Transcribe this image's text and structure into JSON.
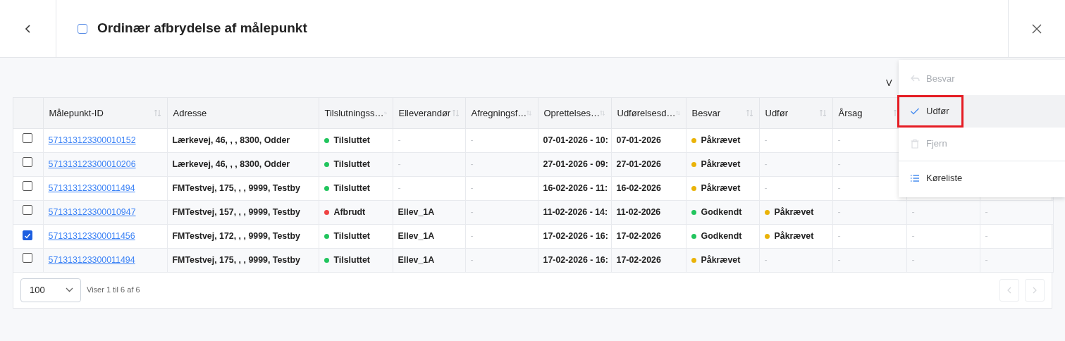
{
  "header": {
    "title": "Ordinær afbrydelse af målepunkt",
    "title_checked": false
  },
  "cut_text": "V",
  "table": {
    "columns": [
      {
        "label": "Målepunkt-ID",
        "sortable": true
      },
      {
        "label": "Adresse",
        "sortable": false
      },
      {
        "label": "Tilslutningss…",
        "sortable": true
      },
      {
        "label": "Elleverandør",
        "sortable": true
      },
      {
        "label": "Afregningsf…",
        "sortable": true
      },
      {
        "label": "Oprettelses…",
        "sortable": true
      },
      {
        "label": "Udførelsesd…",
        "sortable": true
      },
      {
        "label": "Besvar",
        "sortable": true
      },
      {
        "label": "Udfør",
        "sortable": true
      },
      {
        "label": "Årsag",
        "sortable": true
      }
    ],
    "rows": [
      {
        "selected": false,
        "id": "571313123300010152",
        "address": "Lærkevej, 46, , , 8300, Odder",
        "connection": {
          "text": "Tilsluttet",
          "color": "#22c55e"
        },
        "supplier": "-",
        "settlement": "-",
        "created": "07-01-2026 - 10:",
        "executed": "07-01-2026",
        "answer": {
          "text": "Påkrævet",
          "color": "#eab308"
        },
        "perform": "-",
        "reason": "-"
      },
      {
        "selected": false,
        "id": "571313123300010206",
        "address": "Lærkevej, 46, , , 8300, Odder",
        "connection": {
          "text": "Tilsluttet",
          "color": "#22c55e"
        },
        "supplier": "-",
        "settlement": "-",
        "created": "27-01-2026 - 09:",
        "executed": "27-01-2026",
        "answer": {
          "text": "Påkrævet",
          "color": "#eab308"
        },
        "perform": "-",
        "reason": "-"
      },
      {
        "selected": false,
        "id": "571313123300011494",
        "address": "FMTestvej, 175, , , 9999, Testby",
        "connection": {
          "text": "Tilsluttet",
          "color": "#22c55e"
        },
        "supplier": "-",
        "settlement": "-",
        "created": "16-02-2026 - 11:",
        "executed": "16-02-2026",
        "answer": {
          "text": "Påkrævet",
          "color": "#eab308"
        },
        "perform": "-",
        "reason": "-"
      },
      {
        "selected": false,
        "id": "571313123300010947",
        "address": "FMTestvej, 157, , , 9999, Testby",
        "connection": {
          "text": "Afbrudt",
          "color": "#ef4444"
        },
        "supplier": "Ellev_1A",
        "settlement": "-",
        "created": "11-02-2026 - 14:",
        "executed": "11-02-2026",
        "answer": {
          "text": "Godkendt",
          "color": "#22c55e"
        },
        "perform": {
          "text": "Påkrævet",
          "color": "#eab308"
        },
        "reason": "-",
        "column_11": "-",
        "column_12": "-"
      },
      {
        "selected": true,
        "id": "571313123300011456",
        "address": "FMTestvej, 172, , , 9999, Testby",
        "connection": {
          "text": "Tilsluttet",
          "color": "#22c55e"
        },
        "supplier": "Ellev_1A",
        "settlement": "-",
        "created": "17-02-2026 - 16:",
        "executed": "17-02-2026",
        "answer": {
          "text": "Godkendt",
          "color": "#22c55e"
        },
        "perform": {
          "text": "Påkrævet",
          "color": "#eab308"
        },
        "reason": "-",
        "column_11": "-",
        "column_12": "-"
      },
      {
        "selected": false,
        "id": "571313123300011494",
        "address": "FMTestvej, 175, , , 9999, Testby",
        "connection": {
          "text": "Tilsluttet",
          "color": "#22c55e"
        },
        "supplier": "Ellev_1A",
        "settlement": "-",
        "created": "17-02-2026 - 16:",
        "executed": "17-02-2026",
        "answer": {
          "text": "Påkrævet",
          "color": "#eab308"
        },
        "perform": "-",
        "reason": "-",
        "column_11": "-",
        "column_12": "-"
      }
    ],
    "page_size": "100",
    "summary": "Viser 1 til 6 af 6",
    "prev_disabled": true,
    "next_disabled": true
  },
  "menu": {
    "items": [
      {
        "kind": "action",
        "label": "Besvar",
        "disabled": true,
        "selected": false,
        "highlighted": false
      },
      {
        "kind": "action",
        "label": "Udfør",
        "disabled": false,
        "selected": true,
        "highlighted": true
      },
      {
        "kind": "action",
        "label": "Fjern",
        "disabled": true,
        "selected": false,
        "highlighted": false
      },
      {
        "kind": "divider"
      },
      {
        "kind": "action",
        "label": "Køreliste",
        "disabled": false,
        "selected": false,
        "highlighted": false
      }
    ]
  }
}
